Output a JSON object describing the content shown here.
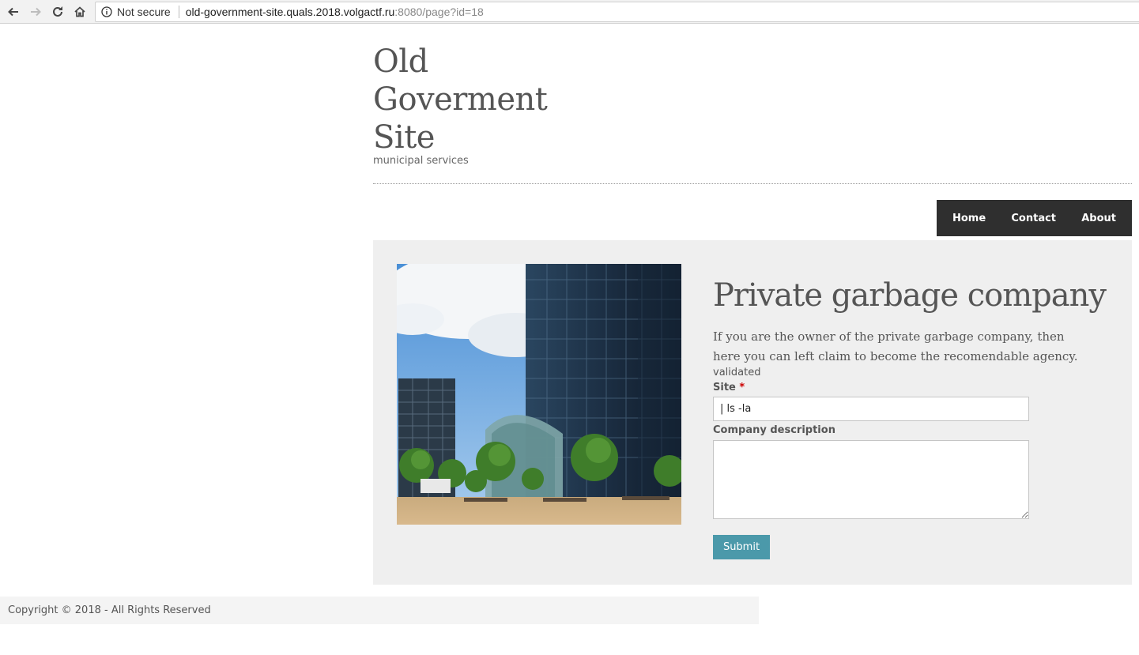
{
  "browser": {
    "security_label": "Not secure",
    "url_host": "old-government-site.quals.2018.volgactf.ru",
    "url_rest": ":8080/page?id=18"
  },
  "site": {
    "title": "Old Goverment Site",
    "tagline": "municipal services"
  },
  "menu": {
    "items": [
      {
        "label": "Home"
      },
      {
        "label": "Contact"
      },
      {
        "label": "About"
      }
    ]
  },
  "page": {
    "heading": "Private garbage company",
    "intro": "If you are the owner of the private garbage company, then here you can left claim to become the recomendable agency.",
    "status": "validated"
  },
  "form": {
    "site_label": "Site",
    "site_required_mark": "*",
    "site_value": "| ls -la",
    "description_label": "Company description",
    "description_value": "",
    "submit_label": "Submit"
  },
  "footer": {
    "copyright": "Copyright © 2018 - All Rights Reserved"
  },
  "colors": {
    "menu_bg": "#2f2f2f",
    "content_bg": "#efefef",
    "submit_bg": "#4b99aa",
    "required": "#cc0000"
  },
  "icons": [
    "back-arrow-icon",
    "forward-arrow-icon",
    "reload-icon",
    "home-icon",
    "info-icon"
  ]
}
